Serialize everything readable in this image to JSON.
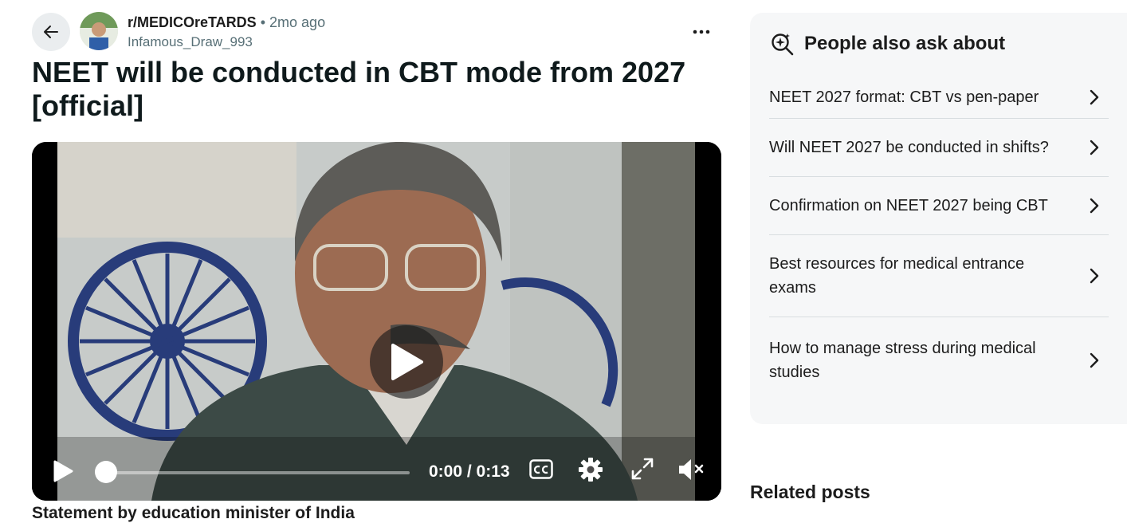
{
  "post": {
    "subreddit": "r/MEDICOreTARDS",
    "separator": "•",
    "time_ago": "2mo ago",
    "author": "Infamous_Draw_993",
    "more_label": "...",
    "title": "NEET will be conducted in CBT mode from 2027 [official]",
    "caption": "Statement by education minister of India"
  },
  "video": {
    "time_display": "0:00 / 0:13",
    "progress": 0,
    "icons": [
      "play-icon",
      "closed-captions-icon",
      "gear-icon",
      "expand-icon",
      "muted-speaker-icon"
    ]
  },
  "sidebar": {
    "people_also_ask": {
      "title": "People also ask about",
      "icon": "sparkle-search-icon",
      "items": [
        {
          "label": "NEET 2027 format: CBT vs pen-paper"
        },
        {
          "label": "Will NEET 2027 be conducted in shifts?"
        },
        {
          "label": "Confirmation on NEET 2027 being CBT"
        },
        {
          "label": "Best resources for medical entrance exams"
        },
        {
          "label": "How to manage stress during medical studies"
        }
      ]
    },
    "related_posts": {
      "title": "Related posts"
    }
  },
  "colors": {
    "meta_gray": "#576f76",
    "panel_bg": "#f6f7f8",
    "button_bg": "#eaedef"
  }
}
